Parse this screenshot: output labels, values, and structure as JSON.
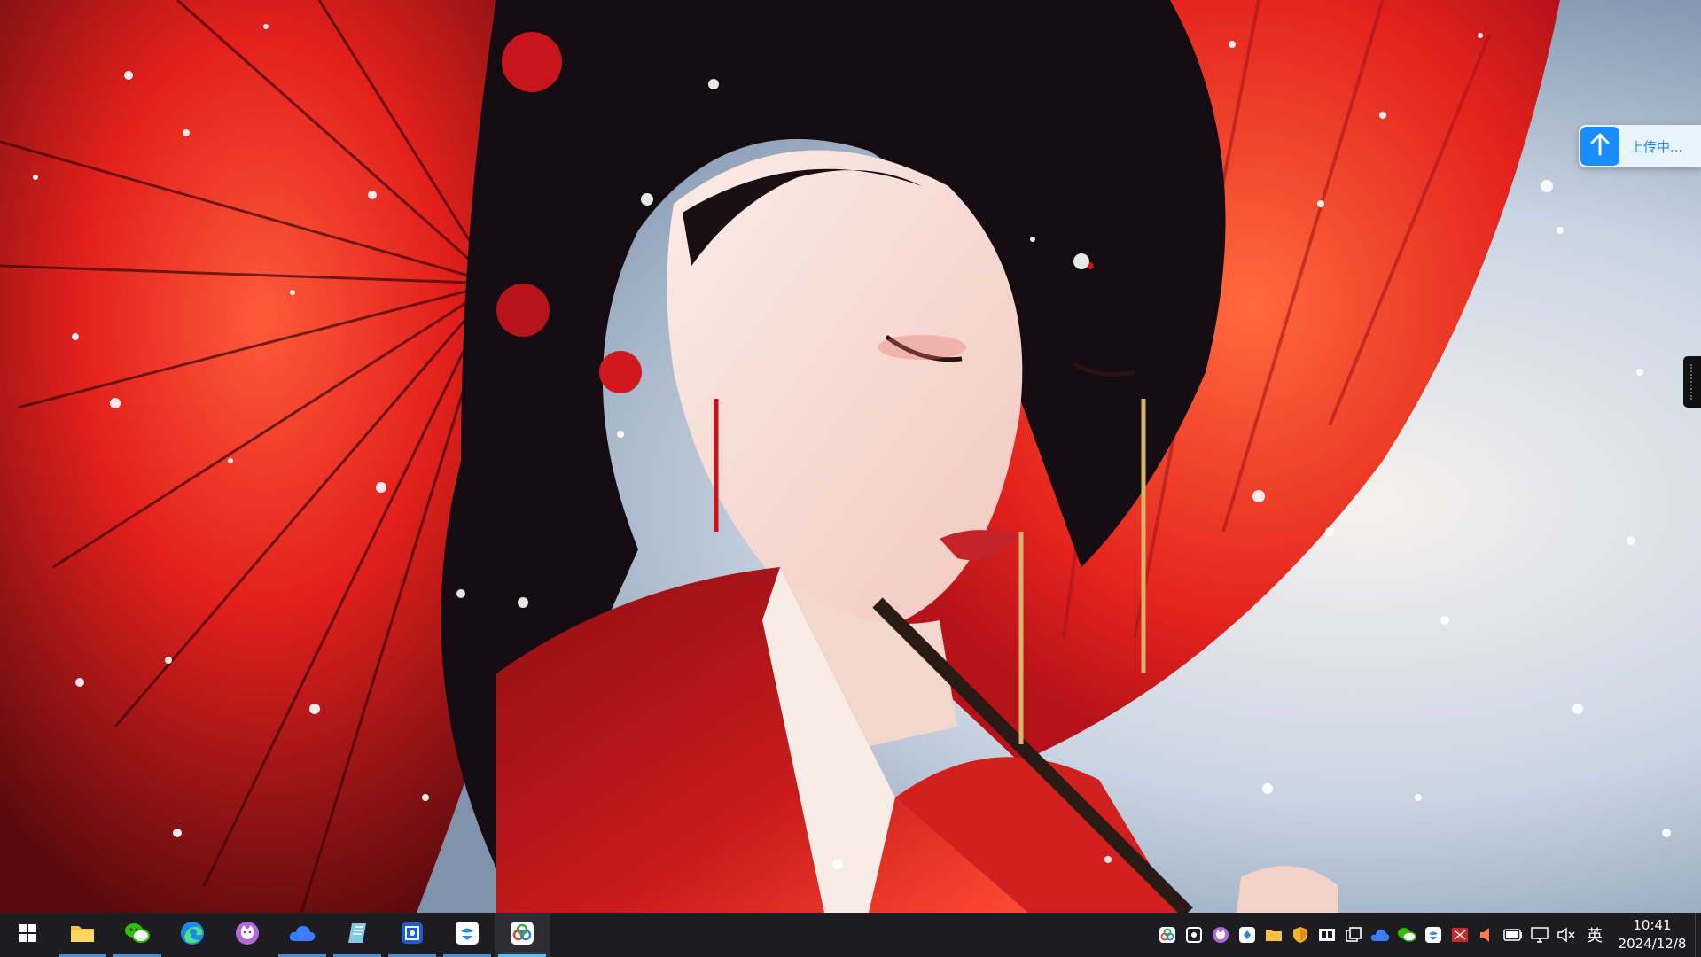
{
  "desktop": {
    "wallpaper": "anime-girl-red-umbrella-snow",
    "accent_color": "#e0201e"
  },
  "upload_widget": {
    "label": "上传中...",
    "icon": "arrow-up-icon",
    "color": "#1a8cff"
  },
  "taskbar": {
    "pinned": [
      {
        "name": "start",
        "icon": "windows-logo-icon"
      },
      {
        "name": "file-explorer",
        "icon": "folder-icon"
      },
      {
        "name": "wechat",
        "icon": "wechat-icon"
      },
      {
        "name": "edge",
        "icon": "edge-browser-icon"
      },
      {
        "name": "cat-app",
        "icon": "cat-app-icon"
      },
      {
        "name": "baidu-netdisk",
        "icon": "cloud-icon"
      },
      {
        "name": "notebook",
        "icon": "notebook-icon"
      },
      {
        "name": "screenshot-tool",
        "icon": "screenshot-icon"
      },
      {
        "name": "cloud-music",
        "icon": "cloud-music-icon"
      },
      {
        "name": "baidu-netdisk-active",
        "icon": "netdisk-icon"
      }
    ],
    "tray": {
      "icons": [
        "netdisk-tray-icon",
        "capture-tray-icon",
        "cat-tray-icon",
        "app-tray-icon",
        "folder-tray-icon",
        "security-shield-icon",
        "media-tray-icon",
        "window-tray-icon",
        "cloud-tray-icon",
        "wechat-tray-icon",
        "cloud-music-tray-icon",
        "flag-tray-icon",
        "speaker-tray-icon",
        "battery-icon",
        "network-icon",
        "volume-muted-icon"
      ],
      "language": "英",
      "time": "10:41",
      "date": "2024/12/8"
    }
  }
}
